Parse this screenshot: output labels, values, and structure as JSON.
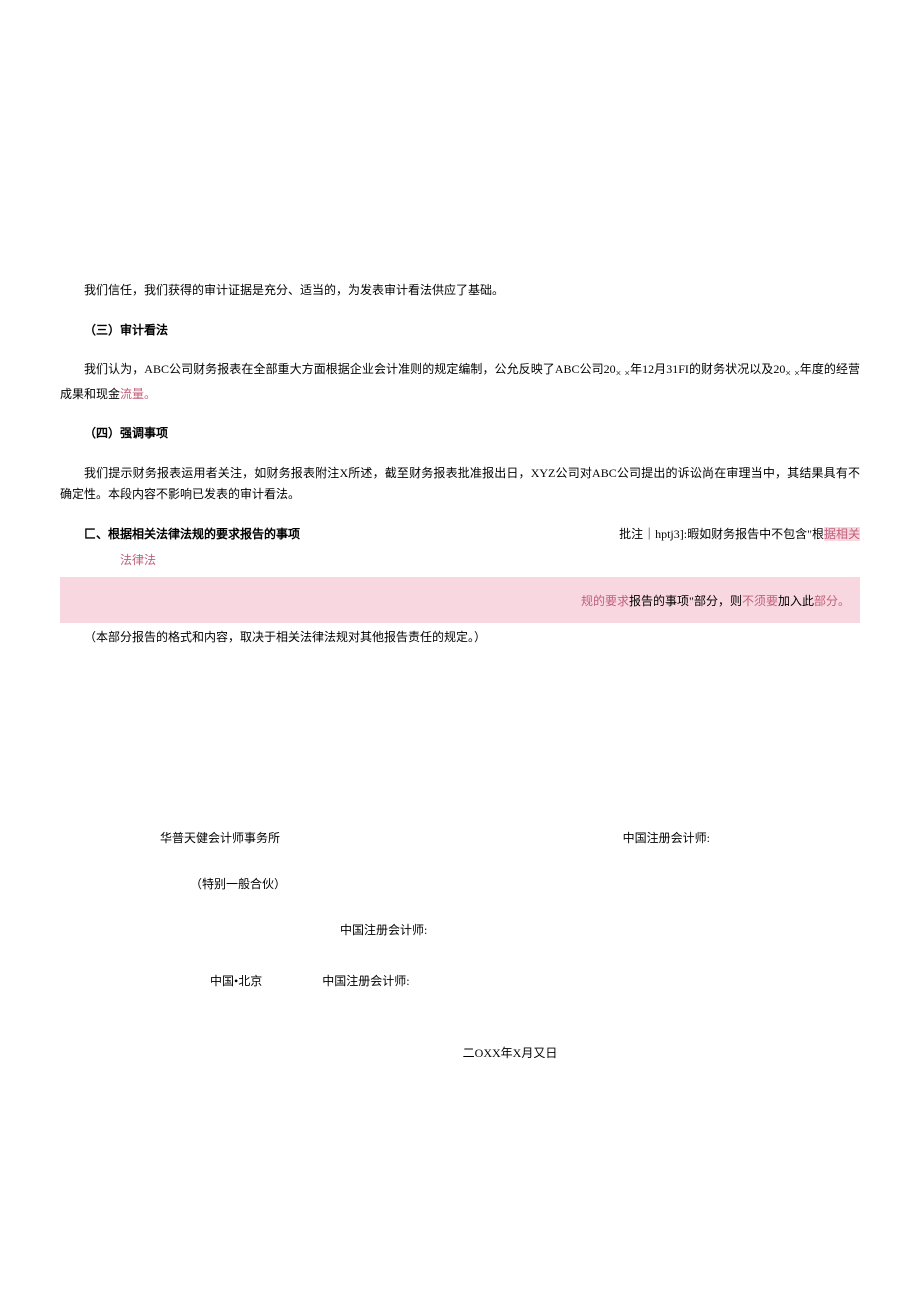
{
  "paragraphs": {
    "intro": "我们信任，我们获得的审计证据是充分、适当的，为发表审计看法供应了基础。",
    "section3_heading": "（三）审计看法",
    "section3_body_part1": "我们认为，ABC公司财务报表在全部重大方面根据企业会计准则的规定编制，公允反映了ABC公司20",
    "section3_body_x1": "×",
    "section3_body_x2": "×",
    "section3_body_part2": "年12月31FI的财务状况以及20",
    "section3_body_x3": "×",
    "section3_body_x4": "×",
    "section3_body_part3": "年度的经营成果和现金",
    "section3_body_link": "流量。",
    "section4_heading": "（四）强调事项",
    "section4_body": "我们提示财务报表运用者关注，如财务报表附注X所述，截至财务报表批准报出日，XYZ公司对ABC公司提出的诉讼尚在审理当中，其结果具有不确定性。本段内容不影响已发表的审计看法。",
    "section5_heading": "匚、根据相关法律法规的要求报告的事项",
    "section5_note": "（本部分报告的格式和内容，取决于相关法律法规对其他报告责任的规定。）"
  },
  "comment": {
    "label": "批注｜hptj3]:",
    "text_part1": "暇如财务报告中不包含\"根",
    "text_faded1": "据相关",
    "wrap_line": "法律法",
    "highlight_faded_left": "规",
    "highlight_mid_faded": "的要求",
    "highlight_mid_text": "报告的事项\"部分，则",
    "highlight_mid_faded2": "不须要",
    "highlight_mid_text2": "加入此",
    "highlight_faded_right": "部分。"
  },
  "signature": {
    "firm": "华普天健会计师事务所",
    "partnership": "（特别一般合伙）",
    "cpa_label": "中国注册会计师:",
    "location": "中国•北京",
    "date": "二OXX年X月又日"
  }
}
